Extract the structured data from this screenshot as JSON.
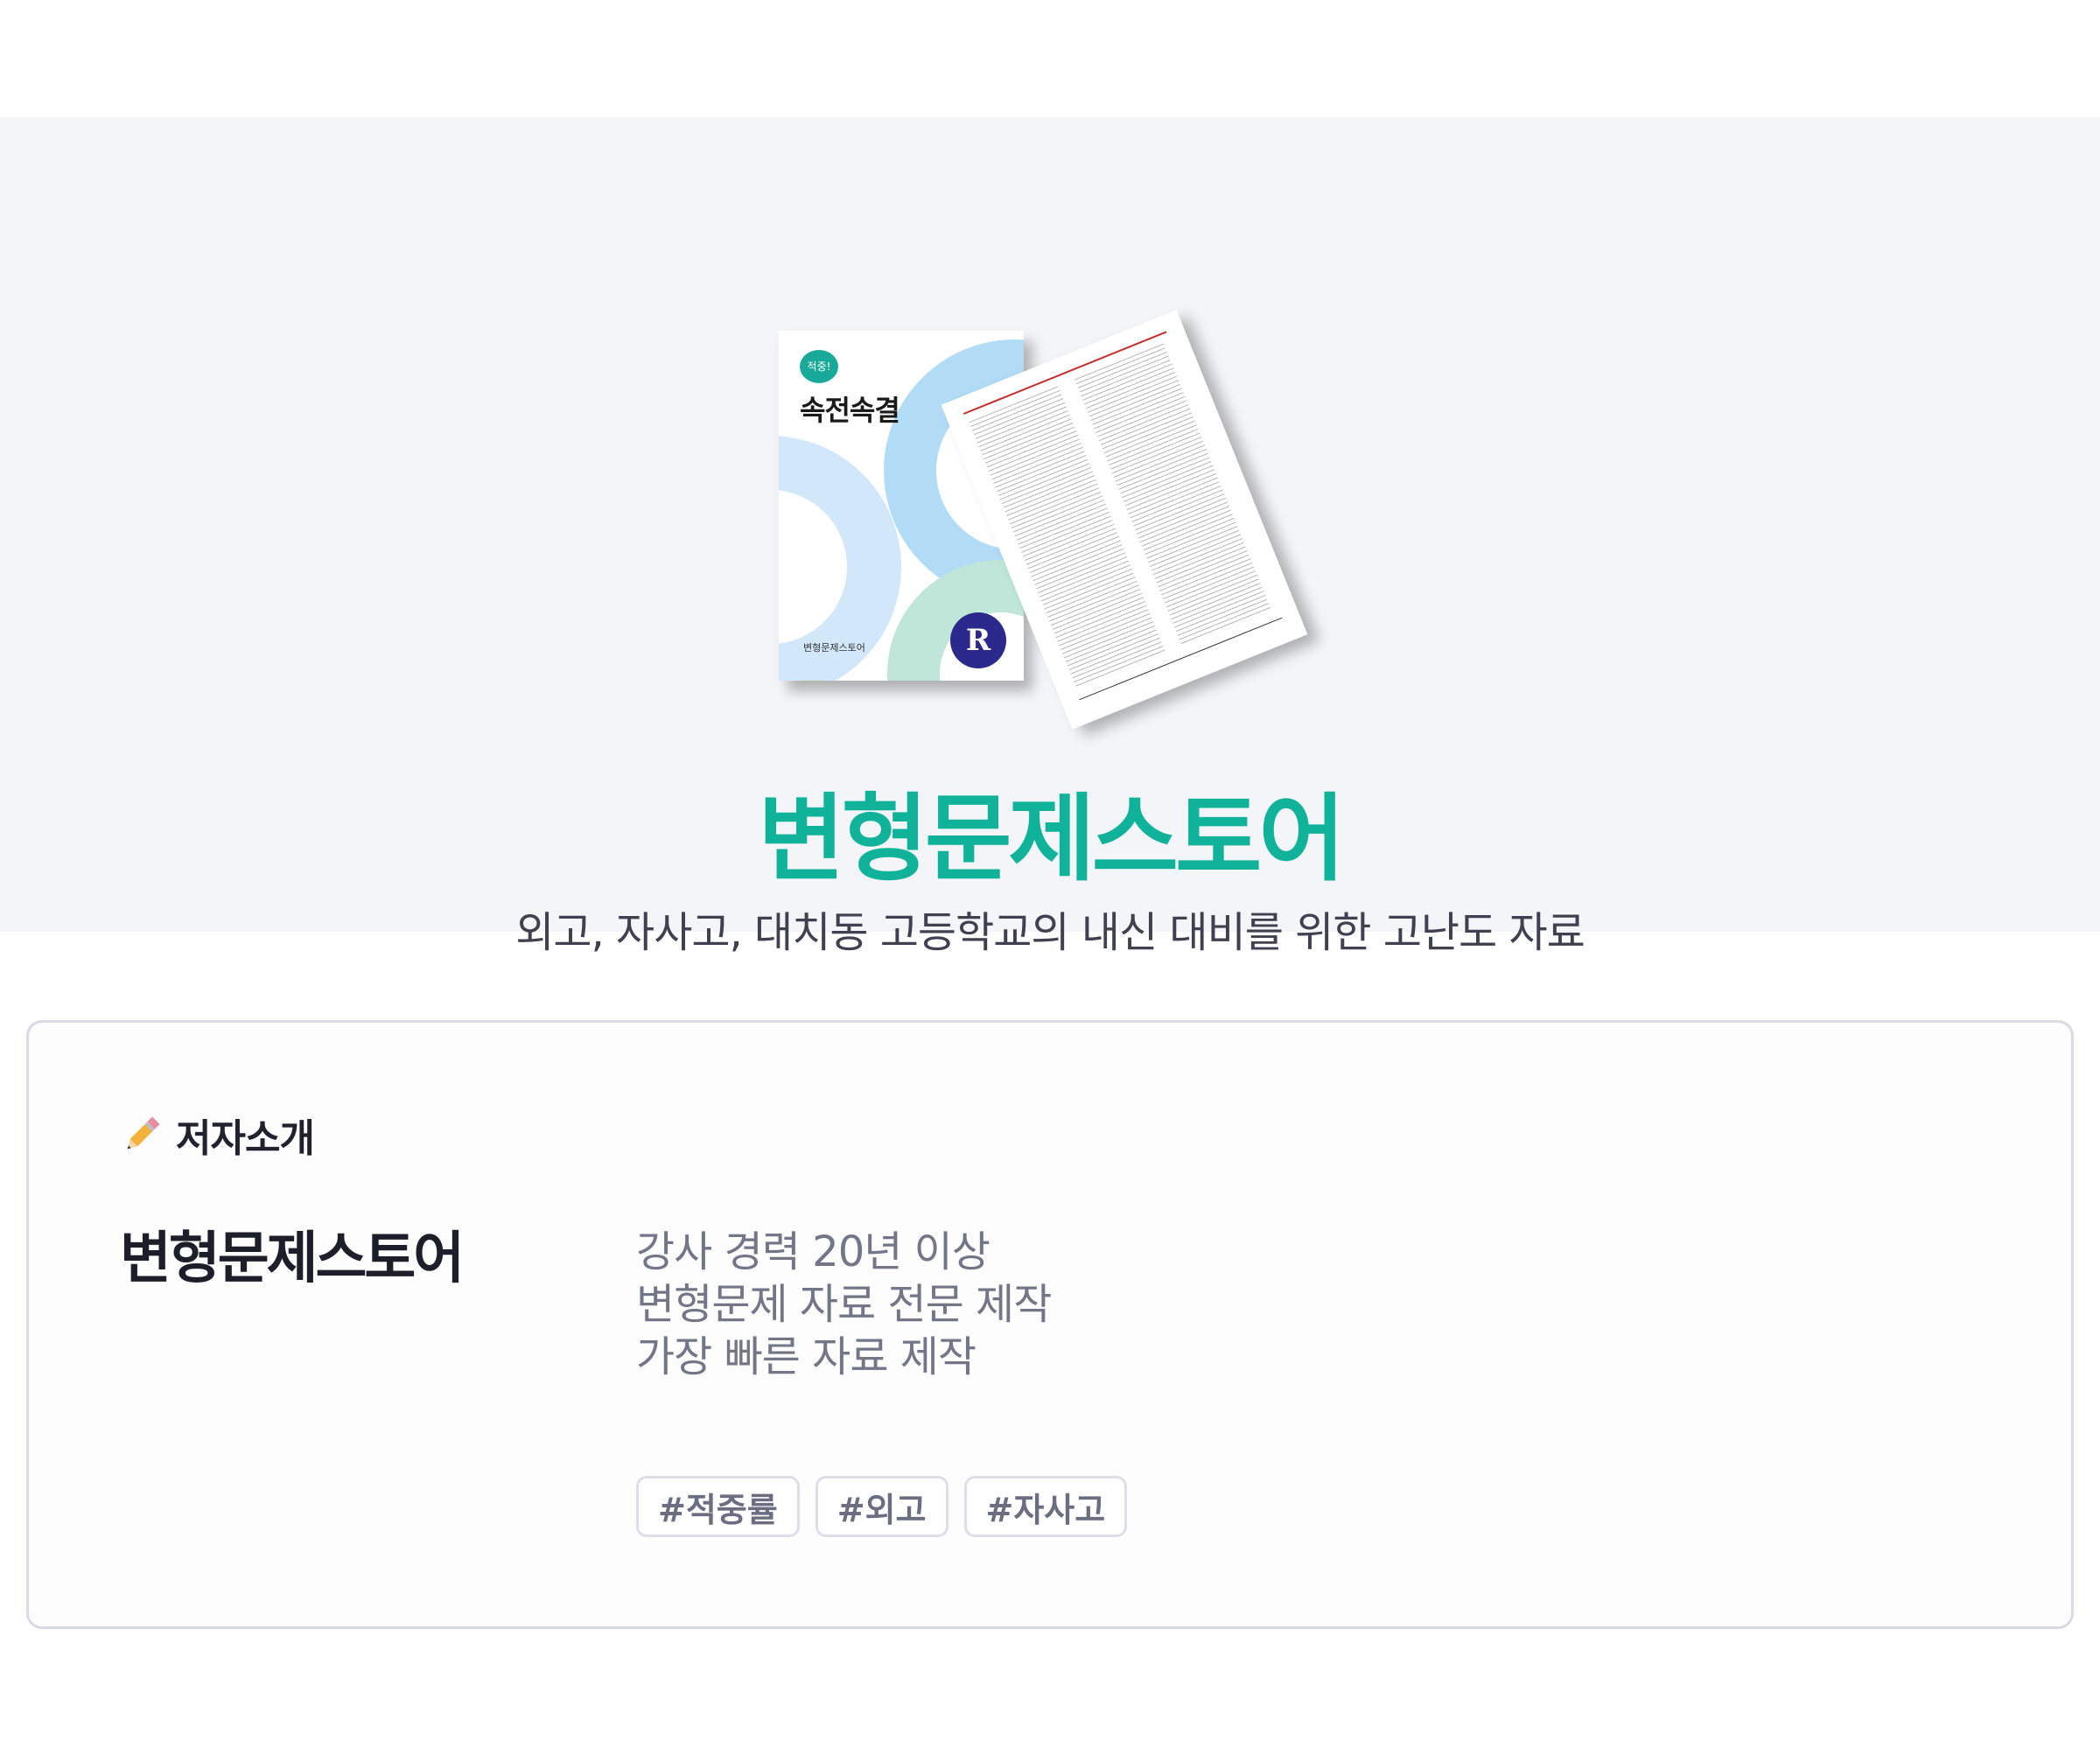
{
  "hero": {
    "cover": {
      "bubble": "적중!",
      "title": "속전속결",
      "brand": "변형문제스토어",
      "logo_letter": "R"
    },
    "title": "변형문제스토어",
    "subtitle": "외고, 자사고, 대치동 고등학교의 내신 대비를 위한 고난도 자료",
    "title_color": "#10b39a"
  },
  "author_section": {
    "icon": "pencil-icon",
    "label": "저자소개",
    "name": "변형문제스토어",
    "bio": [
      "강사 경력 20년 이상",
      "변형문제 자료 전문 제작",
      "가장 빠른 자료 제작"
    ],
    "tags": [
      "#적중률",
      "#외고",
      "#자사고"
    ]
  }
}
